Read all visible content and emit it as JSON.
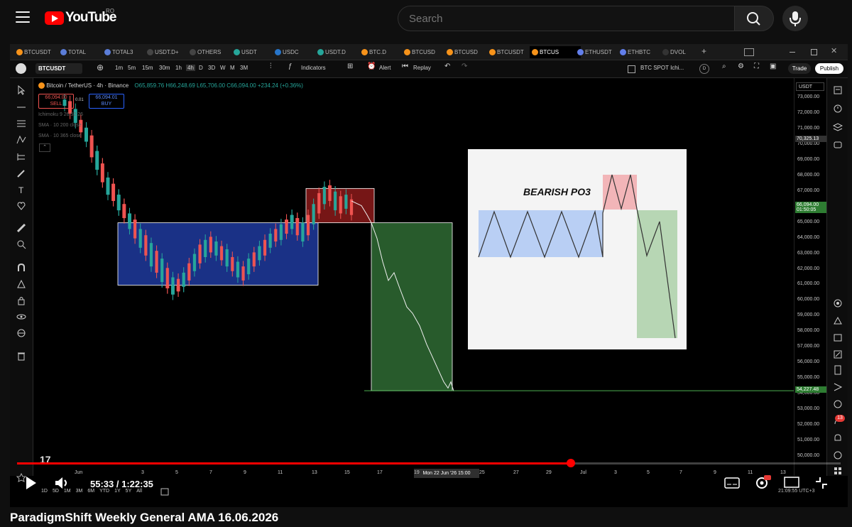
{
  "youtube": {
    "logo_text": "YouTube",
    "region": "RO",
    "search_placeholder": "Search",
    "video_title": "ParadigmShift Weekly General AMA 16.06.2026",
    "current_time": "55:33",
    "separator": " / ",
    "duration": "1:22:35",
    "progress_fraction": 0.672
  },
  "tabs": [
    {
      "label": "BTCUSDT"
    },
    {
      "label": "TOTAL"
    },
    {
      "label": "TOTAL3"
    },
    {
      "label": "USDT.D+"
    },
    {
      "label": "OTHERS"
    },
    {
      "label": "USDT"
    },
    {
      "label": "USDC"
    },
    {
      "label": "USDT.D"
    },
    {
      "label": "BTC.D"
    },
    {
      "label": "BTCUSD"
    },
    {
      "label": "BTCUSD"
    },
    {
      "label": "BTCUSDT"
    },
    {
      "label": "BTCUS"
    },
    {
      "label": "ETHUSDT"
    },
    {
      "label": "ETHBTC"
    },
    {
      "label": "DVOL"
    }
  ],
  "toolbar": {
    "symbol": "BTCUSDT",
    "timeframes": [
      "1m",
      "5m",
      "15m",
      "30m",
      "1h",
      "4h",
      "D",
      "3D",
      "W",
      "M",
      "3M"
    ],
    "active_timeframe": "4h",
    "indicators": "Indicators",
    "alert": "Alert",
    "replay": "Replay",
    "layout_name": "BTC SPOT Ichi...",
    "layout_d": "D",
    "trade": "Trade",
    "publish": "Publish"
  },
  "legend": {
    "pair": "Bitcoin / TetherUS · 4h · Binance",
    "ohlc": "O65,859.76 H66,248.69 L65,706.00 C66,094.00 +234.24 (+0.36%)",
    "sell_price": "66,094.00",
    "sell_label": "SELL",
    "spread": "0.01",
    "buy_price": "66,094.01",
    "buy_label": "BUY",
    "indicators": [
      "Ichimoku 9 26 52 26",
      "SMA · 10 200 close",
      "SMA · 10 365 close"
    ]
  },
  "price_axis": {
    "currency": "USDT",
    "labels": [
      "73,000.00",
      "72,000.00",
      "71,000.00",
      "70,000.00",
      "69,000.00",
      "68,000.00",
      "67,000.00",
      "66,000.00",
      "65,000.00",
      "64,000.00",
      "63,000.00",
      "62,000.00",
      "61,000.00",
      "60,000.00",
      "59,000.00",
      "58,000.00",
      "57,000.00",
      "56,000.00",
      "55,000.00",
      "54,000.00",
      "53,000.00",
      "52,000.00",
      "51,000.00",
      "50,000.00"
    ],
    "crosshair_price": "70,325.13",
    "last_price": "66,094.00",
    "countdown": "01:50:05",
    "level_price": "54,227.48"
  },
  "time_axis": {
    "labels": [
      "Jun",
      "3",
      "5",
      "7",
      "9",
      "11",
      "13",
      "15",
      "17",
      "19",
      "25",
      "27",
      "29",
      "Jul",
      "3",
      "5",
      "7",
      "9",
      "11",
      "13"
    ],
    "cursor_label": "Mon 22 Jun '26   15:00"
  },
  "inset": {
    "title": "BEARISH PO3"
  },
  "controls": {
    "ranges": [
      "1D",
      "5D",
      "1M",
      "3M",
      "6M",
      "YTD",
      "1Y",
      "5Y",
      "All"
    ],
    "utc": "21:09:55 UTC+3",
    "notifications": "13",
    "tv_logo": "17"
  },
  "colors": {
    "accumulation_box": "#1f3a9e",
    "manipulation_box": "#8b1a1a",
    "distribution_box": "#2f6b34",
    "progress": "#ff0000",
    "candle_up": "#26a69a",
    "candle_down": "#ef5350"
  }
}
